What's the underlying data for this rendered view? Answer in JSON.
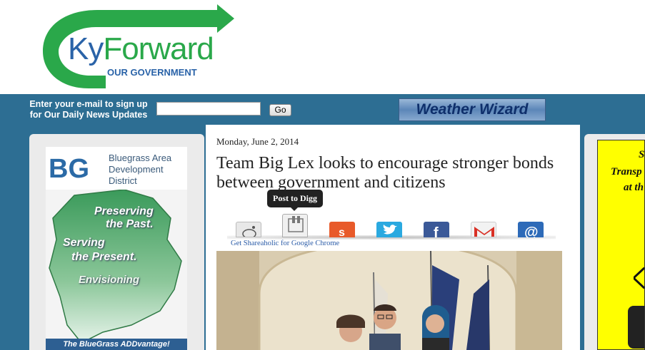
{
  "logo": {
    "part1": "Ky",
    "part2": "Forward",
    "subtitle": "OUR GOVERNMENT"
  },
  "signup": {
    "line1": "Enter your e-mail to sign up",
    "line2": "for Our Daily News Updates",
    "input_value": "",
    "button": "Go"
  },
  "weather": {
    "label": "Weather Wizard"
  },
  "left_ad": {
    "logo": "BG",
    "name_lines": [
      "Bluegrass Area",
      "Development",
      "District"
    ],
    "text1a": "Preserving",
    "text1b": "the Past.",
    "text2a": "Serving",
    "text2b": "the Present.",
    "text3": "Envisioning",
    "tagline": "The BlueGrass ADDvantage!"
  },
  "article": {
    "date": "Monday, June 2, 2014",
    "title": "Team Big Lex looks to encourage stronger bonds between government and citizens",
    "tooltip": "Post to Digg",
    "share_icons": [
      "reddit-icon",
      "digg-icon",
      "stumbleupon-icon",
      "twitter-icon",
      "facebook-icon",
      "gmail-icon",
      "email-icon"
    ],
    "chrome_link": "Get Shareaholic for Google Chrome"
  },
  "right_ad": {
    "line1": "S",
    "line2": "Transp",
    "line3": "at th"
  },
  "colors": {
    "bluebar": "#2d6e93",
    "logo_blue": "#2a63a8",
    "logo_green": "#2aa84a",
    "ad_yellow": "#ffff00"
  }
}
